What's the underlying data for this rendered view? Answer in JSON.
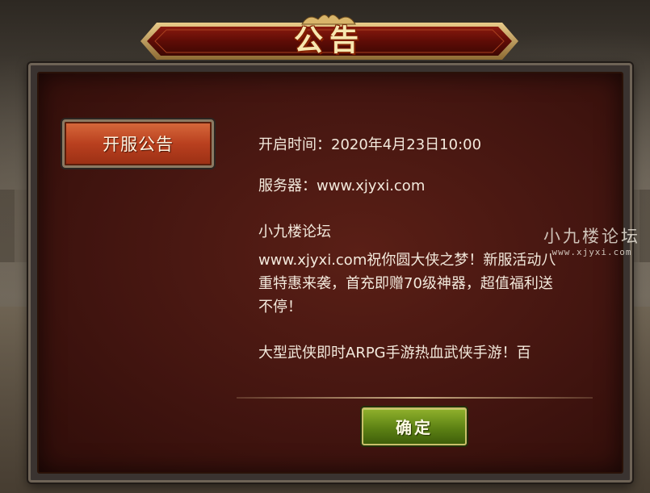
{
  "dialog": {
    "title": "公告"
  },
  "tabs": [
    {
      "label": "开服公告",
      "selected": true
    }
  ],
  "announcement": {
    "open_time": "开启时间：2020年4月23日10:00",
    "server": "服务器：www.xjyxi.com",
    "forum": "小九楼论坛",
    "paragraph": "www.xjyxi.com祝你圆大侠之梦！新服活动八重特惠来袭，首充即赠70级神器，超值福利送不停！",
    "paragraph_2_partial": "大型武侠即时ARPG手游热血武侠手游！百"
  },
  "buttons": {
    "confirm": "确定"
  },
  "watermark": {
    "title": "小九楼论坛",
    "url": "www.xjyxi.com"
  },
  "colors": {
    "panel_red": "#431510",
    "tab_orange": "#b9401f",
    "confirm_green": "#5d8214",
    "title_gold": "#f7e7b0"
  }
}
